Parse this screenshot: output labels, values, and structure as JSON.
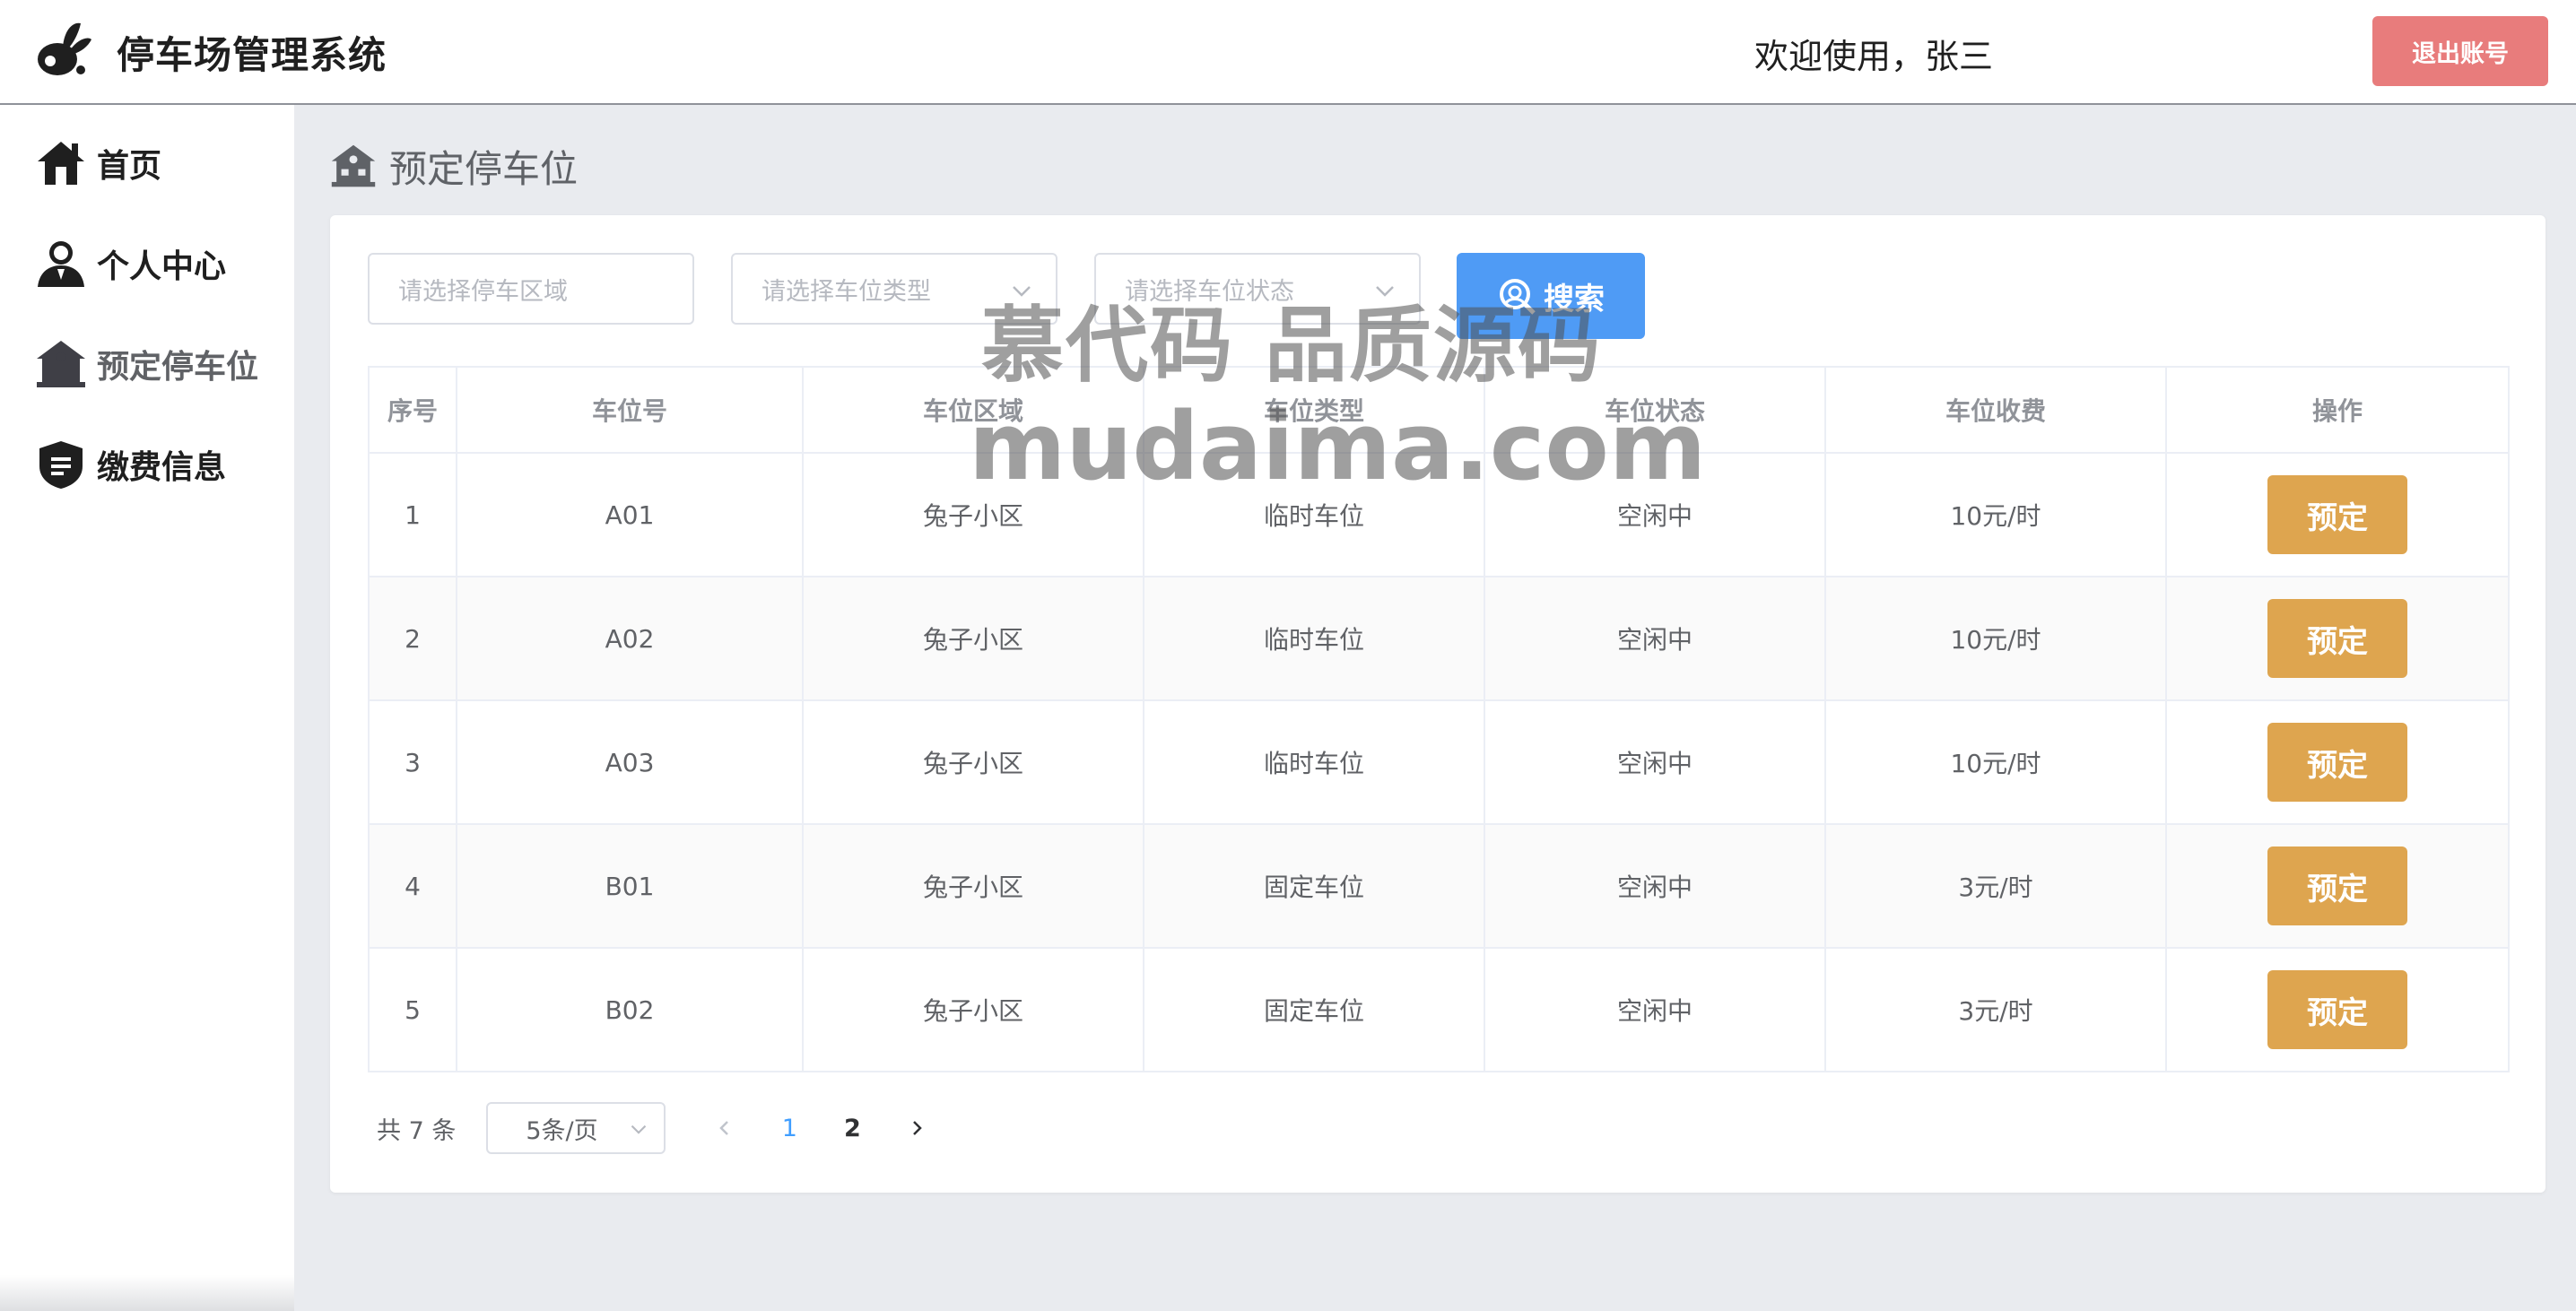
{
  "header": {
    "app_title": "停车场管理系统",
    "welcome_text": "欢迎使用，张三",
    "logout_label": "退出账号",
    "logo_icon": "rabbit-logo-icon"
  },
  "sidebar": {
    "items": [
      {
        "label": "首页",
        "icon": "home-icon"
      },
      {
        "label": "个人中心",
        "icon": "user-icon"
      },
      {
        "label": "预定停车位",
        "icon": "parking-house-icon"
      },
      {
        "label": "缴费信息",
        "icon": "shield-document-icon"
      }
    ],
    "active_index": 2
  },
  "page": {
    "heading": "预定停车位"
  },
  "filters": {
    "area_placeholder": "请选择停车区域",
    "type_placeholder": "请选择车位类型",
    "status_placeholder": "请选择车位状态",
    "search_label": "搜索"
  },
  "table": {
    "headers": [
      "序号",
      "车位号",
      "车位区域",
      "车位类型",
      "车位状态",
      "车位收费",
      "操作"
    ],
    "rows": [
      {
        "index": "1",
        "number": "A01",
        "area": "兔子小区",
        "type": "临时车位",
        "status": "空闲中",
        "fee": "10元/时",
        "action": "预定"
      },
      {
        "index": "2",
        "number": "A02",
        "area": "兔子小区",
        "type": "临时车位",
        "status": "空闲中",
        "fee": "10元/时",
        "action": "预定"
      },
      {
        "index": "3",
        "number": "A03",
        "area": "兔子小区",
        "type": "临时车位",
        "status": "空闲中",
        "fee": "10元/时",
        "action": "预定"
      },
      {
        "index": "4",
        "number": "B01",
        "area": "兔子小区",
        "type": "固定车位",
        "status": "空闲中",
        "fee": "3元/时",
        "action": "预定"
      },
      {
        "index": "5",
        "number": "B02",
        "area": "兔子小区",
        "type": "固定车位",
        "status": "空闲中",
        "fee": "3元/时",
        "action": "预定"
      }
    ]
  },
  "pagination": {
    "total_text": "共 7 条",
    "page_size": "5条/页",
    "pages": [
      "1",
      "2"
    ],
    "current_page": "1"
  },
  "watermark": {
    "line1": "慕代码 品质源码",
    "line2": "mudaima.com"
  },
  "colors": {
    "logout": "#e87c7c",
    "search": "#4f9bf5",
    "reserve": "#dea54f",
    "active_page": "#409eff"
  }
}
